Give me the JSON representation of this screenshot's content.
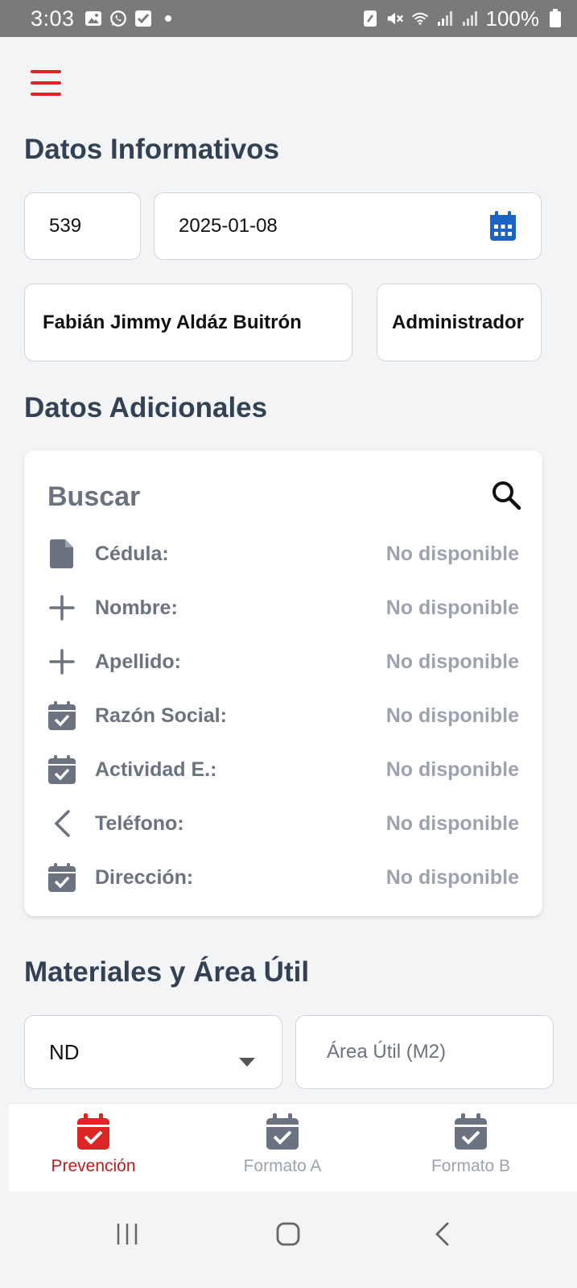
{
  "status_bar": {
    "time": "3:03",
    "battery": "100%"
  },
  "sections": {
    "info_title": "Datos Informativos",
    "additional_title": "Datos Adicionales",
    "materials_title": "Materiales y Área Útil"
  },
  "info": {
    "number": "539",
    "date": "2025-01-08",
    "user_name": "Fabián Jimmy Aldáz Buitrón",
    "role": "Administrador"
  },
  "additional": {
    "search_label": "Buscar",
    "rows": [
      {
        "label": "Cédula:",
        "value": "No disponible",
        "icon": "document-icon"
      },
      {
        "label": "Nombre:",
        "value": "No disponible",
        "icon": "plus-icon"
      },
      {
        "label": "Apellido:",
        "value": "No disponible",
        "icon": "plus-icon"
      },
      {
        "label": "Razón Social:",
        "value": "No disponible",
        "icon": "calendar-check-icon"
      },
      {
        "label": "Actividad E.:",
        "value": "No disponible",
        "icon": "calendar-check-icon"
      },
      {
        "label": "Teléfono:",
        "value": "No disponible",
        "icon": "chevron-left-icon"
      },
      {
        "label": "Dirección:",
        "value": "No disponible",
        "icon": "calendar-check-icon"
      }
    ]
  },
  "materials": {
    "select_value": "ND",
    "area_placeholder": "Área Útil (M2)"
  },
  "bottom_nav": {
    "items": [
      {
        "label": "Prevención",
        "active": true
      },
      {
        "label": "Formato A",
        "active": false
      },
      {
        "label": "Formato B",
        "active": false
      }
    ]
  },
  "colors": {
    "accent": "#dc2626",
    "active_tab": "#b91c1c",
    "calendar_blue": "#1d63c4",
    "muted": "#6b7280",
    "value_grey": "#9ca3af"
  }
}
